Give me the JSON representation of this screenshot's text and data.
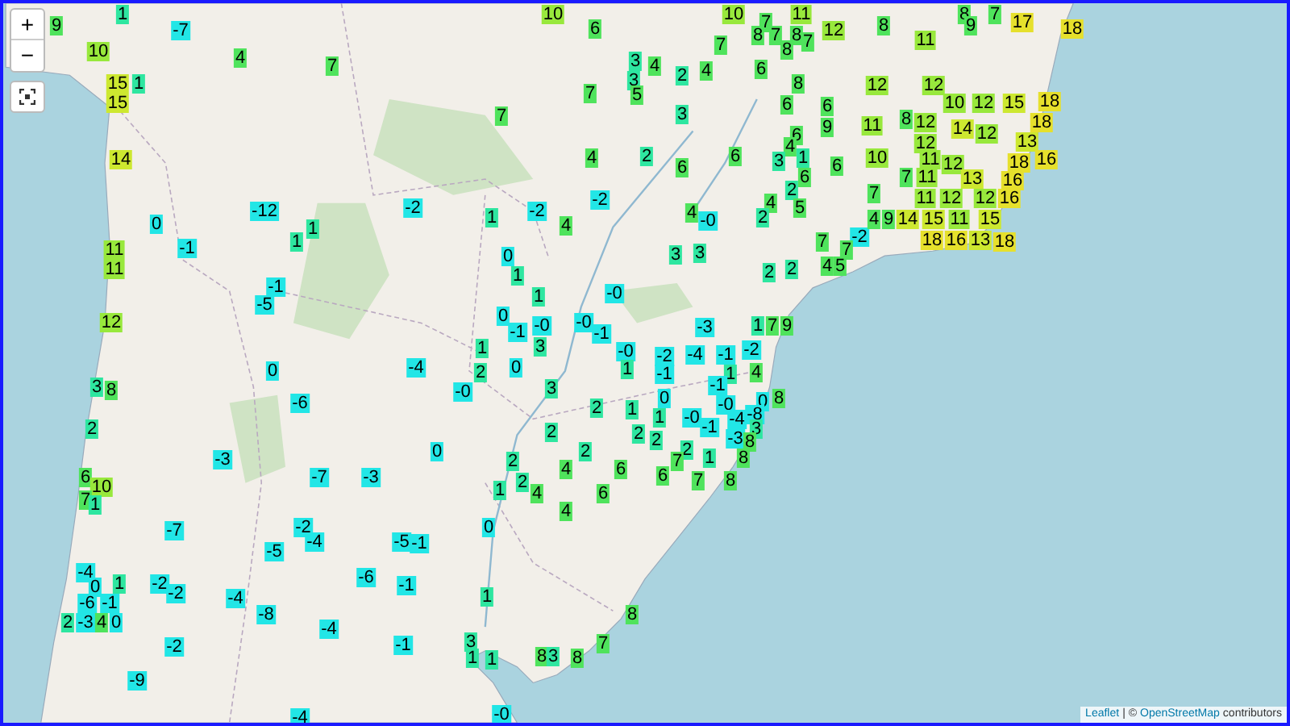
{
  "map": {
    "zoom_controls": [
      {
        "kind": "in",
        "label": "+"
      },
      {
        "kind": "out",
        "label": "−"
      }
    ],
    "markers": [
      {
        "value": "9",
        "color": "#4fe35c"
      },
      {
        "value": "1",
        "color": "#2ee6a0"
      },
      {
        "value": "-7",
        "color": "#22e6e6"
      },
      {
        "value": "4",
        "color": "#4fe35c"
      },
      {
        "value": "7",
        "color": "#4fe35c"
      },
      {
        "value": "10",
        "color": "#98e83c"
      },
      {
        "value": "15",
        "color": "#cde830"
      },
      {
        "value": "15",
        "color": "#cde830"
      },
      {
        "value": "1",
        "color": "#2ee6a0"
      },
      {
        "value": "14",
        "color": "#cde830"
      },
      {
        "value": "-12",
        "color": "#22e6e6"
      },
      {
        "value": "-2",
        "color": "#22e6e6"
      },
      {
        "value": "0",
        "color": "#22e6e6"
      },
      {
        "value": "-1",
        "color": "#22e6e6"
      },
      {
        "value": "1",
        "color": "#2ee6a0"
      },
      {
        "value": "1",
        "color": "#2ee6a0"
      },
      {
        "value": "11",
        "color": "#98e83c"
      },
      {
        "value": "11",
        "color": "#98e83c"
      },
      {
        "value": "-1",
        "color": "#22e6e6"
      },
      {
        "value": "-5",
        "color": "#22e6e6"
      },
      {
        "value": "12",
        "color": "#98e83c"
      },
      {
        "value": "10",
        "color": "#98e83c"
      },
      {
        "value": "10",
        "color": "#98e83c"
      },
      {
        "value": "7",
        "color": "#4fe35c"
      },
      {
        "value": "11",
        "color": "#98e83c"
      },
      {
        "value": "6",
        "color": "#4fe35c"
      },
      {
        "value": "8",
        "color": "#4fe35c"
      },
      {
        "value": "7",
        "color": "#4fe35c"
      },
      {
        "value": "8",
        "color": "#4fe35c"
      },
      {
        "value": "12",
        "color": "#98e83c"
      },
      {
        "value": "7",
        "color": "#4fe35c"
      },
      {
        "value": "7",
        "color": "#4fe35c"
      },
      {
        "value": "8",
        "color": "#4fe35c"
      },
      {
        "value": "3",
        "color": "#2ee6a0"
      },
      {
        "value": "4",
        "color": "#4fe35c"
      },
      {
        "value": "3",
        "color": "#2ee6a0"
      },
      {
        "value": "2",
        "color": "#2ee6a0"
      },
      {
        "value": "4",
        "color": "#4fe35c"
      },
      {
        "value": "6",
        "color": "#4fe35c"
      },
      {
        "value": "8",
        "color": "#4fe35c"
      },
      {
        "value": "7",
        "color": "#4fe35c"
      },
      {
        "value": "5",
        "color": "#4fe35c"
      },
      {
        "value": "6",
        "color": "#4fe35c"
      },
      {
        "value": "6",
        "color": "#4fe35c"
      },
      {
        "value": "7",
        "color": "#4fe35c"
      },
      {
        "value": "3",
        "color": "#2ee6a0"
      },
      {
        "value": "9",
        "color": "#4fe35c"
      },
      {
        "value": "6",
        "color": "#4fe35c"
      },
      {
        "value": "4",
        "color": "#4fe35c"
      },
      {
        "value": "4",
        "color": "#4fe35c"
      },
      {
        "value": "2",
        "color": "#2ee6a0"
      },
      {
        "value": "6",
        "color": "#4fe35c"
      },
      {
        "value": "6",
        "color": "#4fe35c"
      },
      {
        "value": "3",
        "color": "#2ee6a0"
      },
      {
        "value": "1",
        "color": "#2ee6a0"
      },
      {
        "value": "6",
        "color": "#4fe35c"
      },
      {
        "value": "6",
        "color": "#4fe35c"
      },
      {
        "value": "2",
        "color": "#2ee6a0"
      },
      {
        "value": "-2",
        "color": "#22e6e6"
      },
      {
        "value": "4",
        "color": "#4fe35c"
      },
      {
        "value": "5",
        "color": "#4fe35c"
      },
      {
        "value": "1",
        "color": "#2ee6a0"
      },
      {
        "value": "-2",
        "color": "#22e6e6"
      },
      {
        "value": "4",
        "color": "#4fe35c"
      },
      {
        "value": "4",
        "color": "#4fe35c"
      },
      {
        "value": "-0",
        "color": "#22e6e6"
      },
      {
        "value": "2",
        "color": "#2ee6a0"
      },
      {
        "value": "7",
        "color": "#4fe35c"
      },
      {
        "value": "-2",
        "color": "#22e6e6"
      },
      {
        "value": "0",
        "color": "#22e6e6"
      },
      {
        "value": "3",
        "color": "#2ee6a0"
      },
      {
        "value": "3",
        "color": "#2ee6a0"
      },
      {
        "value": "7",
        "color": "#4fe35c"
      },
      {
        "value": "4",
        "color": "#4fe35c"
      },
      {
        "value": "5",
        "color": "#4fe35c"
      },
      {
        "value": "1",
        "color": "#2ee6a0"
      },
      {
        "value": "2",
        "color": "#2ee6a0"
      },
      {
        "value": "2",
        "color": "#2ee6a0"
      },
      {
        "value": "1",
        "color": "#2ee6a0"
      },
      {
        "value": "-0",
        "color": "#22e6e6"
      },
      {
        "value": "0",
        "color": "#22e6e6"
      },
      {
        "value": "-1",
        "color": "#22e6e6"
      },
      {
        "value": "-0",
        "color": "#22e6e6"
      },
      {
        "value": "-0",
        "color": "#22e6e6"
      },
      {
        "value": "-1",
        "color": "#22e6e6"
      },
      {
        "value": "-3",
        "color": "#22e6e6"
      },
      {
        "value": "1",
        "color": "#2ee6a0"
      },
      {
        "value": "7",
        "color": "#4fe35c"
      },
      {
        "value": "9",
        "color": "#4fe35c"
      },
      {
        "value": "1",
        "color": "#2ee6a0"
      },
      {
        "value": "3",
        "color": "#2ee6a0"
      },
      {
        "value": "-0",
        "color": "#22e6e6"
      },
      {
        "value": "-2",
        "color": "#22e6e6"
      },
      {
        "value": "-4",
        "color": "#22e6e6"
      },
      {
        "value": "-1",
        "color": "#22e6e6"
      },
      {
        "value": "-2",
        "color": "#22e6e6"
      },
      {
        "value": "8",
        "color": "#4fe35c"
      },
      {
        "value": "7",
        "color": "#4fe35c"
      },
      {
        "value": "8",
        "color": "#4fe35c"
      },
      {
        "value": "9",
        "color": "#4fe35c"
      },
      {
        "value": "17",
        "color": "#e6e02c"
      },
      {
        "value": "18",
        "color": "#e6e02c"
      },
      {
        "value": "11",
        "color": "#98e83c"
      },
      {
        "value": "12",
        "color": "#98e83c"
      },
      {
        "value": "12",
        "color": "#98e83c"
      },
      {
        "value": "10",
        "color": "#98e83c"
      },
      {
        "value": "12",
        "color": "#98e83c"
      },
      {
        "value": "15",
        "color": "#cde830"
      },
      {
        "value": "18",
        "color": "#e6e02c"
      },
      {
        "value": "11",
        "color": "#98e83c"
      },
      {
        "value": "8",
        "color": "#4fe35c"
      },
      {
        "value": "12",
        "color": "#98e83c"
      },
      {
        "value": "12",
        "color": "#98e83c"
      },
      {
        "value": "14",
        "color": "#cde830"
      },
      {
        "value": "12",
        "color": "#98e83c"
      },
      {
        "value": "18",
        "color": "#e6e02c"
      },
      {
        "value": "13",
        "color": "#cde830"
      },
      {
        "value": "10",
        "color": "#98e83c"
      },
      {
        "value": "11",
        "color": "#98e83c"
      },
      {
        "value": "12",
        "color": "#98e83c"
      },
      {
        "value": "18",
        "color": "#e6e02c"
      },
      {
        "value": "16",
        "color": "#e6e02c"
      },
      {
        "value": "7",
        "color": "#4fe35c"
      },
      {
        "value": "11",
        "color": "#98e83c"
      },
      {
        "value": "13",
        "color": "#cde830"
      },
      {
        "value": "16",
        "color": "#e6e02c"
      },
      {
        "value": "7",
        "color": "#4fe35c"
      },
      {
        "value": "11",
        "color": "#98e83c"
      },
      {
        "value": "12",
        "color": "#98e83c"
      },
      {
        "value": "12",
        "color": "#98e83c"
      },
      {
        "value": "16",
        "color": "#e6e02c"
      },
      {
        "value": "4",
        "color": "#4fe35c"
      },
      {
        "value": "9",
        "color": "#4fe35c"
      },
      {
        "value": "14",
        "color": "#cde830"
      },
      {
        "value": "15",
        "color": "#cde830"
      },
      {
        "value": "11",
        "color": "#98e83c"
      },
      {
        "value": "15",
        "color": "#cde830"
      },
      {
        "value": "18",
        "color": "#e6e02c"
      },
      {
        "value": "16",
        "color": "#e6e02c"
      },
      {
        "value": "13",
        "color": "#cde830"
      },
      {
        "value": "18",
        "color": "#e6e02c"
      },
      {
        "value": "0",
        "color": "#22e6e6"
      },
      {
        "value": "-4",
        "color": "#22e6e6"
      },
      {
        "value": "3",
        "color": "#2ee6a0"
      },
      {
        "value": "8",
        "color": "#4fe35c"
      },
      {
        "value": "-6",
        "color": "#22e6e6"
      },
      {
        "value": "2",
        "color": "#2ee6a0"
      },
      {
        "value": "-3",
        "color": "#22e6e6"
      },
      {
        "value": "6",
        "color": "#4fe35c"
      },
      {
        "value": "10",
        "color": "#98e83c"
      },
      {
        "value": "-7",
        "color": "#22e6e6"
      },
      {
        "value": "-3",
        "color": "#22e6e6"
      },
      {
        "value": "7",
        "color": "#4fe35c"
      },
      {
        "value": "1",
        "color": "#2ee6a0"
      },
      {
        "value": "-7",
        "color": "#22e6e6"
      },
      {
        "value": "-2",
        "color": "#22e6e6"
      },
      {
        "value": "-4",
        "color": "#22e6e6"
      },
      {
        "value": "-5",
        "color": "#22e6e6"
      },
      {
        "value": "-5",
        "color": "#22e6e6"
      },
      {
        "value": "-1",
        "color": "#22e6e6"
      },
      {
        "value": "-4",
        "color": "#22e6e6"
      },
      {
        "value": "0",
        "color": "#22e6e6"
      },
      {
        "value": "1",
        "color": "#2ee6a0"
      },
      {
        "value": "-2",
        "color": "#22e6e6"
      },
      {
        "value": "-2",
        "color": "#22e6e6"
      },
      {
        "value": "-6",
        "color": "#22e6e6"
      },
      {
        "value": "-1",
        "color": "#22e6e6"
      },
      {
        "value": "-6",
        "color": "#22e6e6"
      },
      {
        "value": "-1",
        "color": "#22e6e6"
      },
      {
        "value": "2",
        "color": "#2ee6a0"
      },
      {
        "value": "-3",
        "color": "#22e6e6"
      },
      {
        "value": "4",
        "color": "#4fe35c"
      },
      {
        "value": "0",
        "color": "#22e6e6"
      },
      {
        "value": "-4",
        "color": "#22e6e6"
      },
      {
        "value": "-8",
        "color": "#22e6e6"
      },
      {
        "value": "-4",
        "color": "#22e6e6"
      },
      {
        "value": "-2",
        "color": "#22e6e6"
      },
      {
        "value": "-1",
        "color": "#22e6e6"
      },
      {
        "value": "-9",
        "color": "#22e6e6"
      },
      {
        "value": "-4",
        "color": "#22e6e6"
      },
      {
        "value": "2",
        "color": "#2ee6a0"
      },
      {
        "value": "0",
        "color": "#22e6e6"
      },
      {
        "value": "1",
        "color": "#2ee6a0"
      },
      {
        "value": "-1",
        "color": "#22e6e6"
      },
      {
        "value": "1",
        "color": "#2ee6a0"
      },
      {
        "value": "4",
        "color": "#4fe35c"
      },
      {
        "value": "-0",
        "color": "#22e6e6"
      },
      {
        "value": "3",
        "color": "#2ee6a0"
      },
      {
        "value": "-1",
        "color": "#22e6e6"
      },
      {
        "value": "0",
        "color": "#22e6e6"
      },
      {
        "value": "-0",
        "color": "#22e6e6"
      },
      {
        "value": "0",
        "color": "#22e6e6"
      },
      {
        "value": "8",
        "color": "#4fe35c"
      },
      {
        "value": "2",
        "color": "#2ee6a0"
      },
      {
        "value": "1",
        "color": "#2ee6a0"
      },
      {
        "value": "1",
        "color": "#2ee6a0"
      },
      {
        "value": "-0",
        "color": "#22e6e6"
      },
      {
        "value": "-4",
        "color": "#22e6e6"
      },
      {
        "value": "-8",
        "color": "#22e6e6"
      },
      {
        "value": "2",
        "color": "#2ee6a0"
      },
      {
        "value": "-1",
        "color": "#22e6e6"
      },
      {
        "value": "3",
        "color": "#2ee6a0"
      },
      {
        "value": "-3",
        "color": "#22e6e6"
      },
      {
        "value": "0",
        "color": "#22e6e6"
      },
      {
        "value": "2",
        "color": "#2ee6a0"
      },
      {
        "value": "2",
        "color": "#2ee6a0"
      },
      {
        "value": "8",
        "color": "#4fe35c"
      },
      {
        "value": "2",
        "color": "#2ee6a0"
      },
      {
        "value": "2",
        "color": "#2ee6a0"
      },
      {
        "value": "2",
        "color": "#2ee6a0"
      },
      {
        "value": "7",
        "color": "#4fe35c"
      },
      {
        "value": "1",
        "color": "#2ee6a0"
      },
      {
        "value": "8",
        "color": "#4fe35c"
      },
      {
        "value": "2",
        "color": "#2ee6a0"
      },
      {
        "value": "4",
        "color": "#4fe35c"
      },
      {
        "value": "6",
        "color": "#4fe35c"
      },
      {
        "value": "6",
        "color": "#4fe35c"
      },
      {
        "value": "7",
        "color": "#4fe35c"
      },
      {
        "value": "8",
        "color": "#4fe35c"
      },
      {
        "value": "1",
        "color": "#2ee6a0"
      },
      {
        "value": "4",
        "color": "#4fe35c"
      },
      {
        "value": "6",
        "color": "#4fe35c"
      },
      {
        "value": "4",
        "color": "#4fe35c"
      },
      {
        "value": "0",
        "color": "#22e6e6"
      },
      {
        "value": "1",
        "color": "#2ee6a0"
      },
      {
        "value": "8",
        "color": "#4fe35c"
      },
      {
        "value": "3",
        "color": "#2ee6a0"
      },
      {
        "value": "7",
        "color": "#4fe35c"
      },
      {
        "value": "1",
        "color": "#2ee6a0"
      },
      {
        "value": "1",
        "color": "#2ee6a0"
      },
      {
        "value": "8",
        "color": "#4fe35c"
      },
      {
        "value": "3",
        "color": "#2ee6a0"
      },
      {
        "value": "8",
        "color": "#4fe35c"
      },
      {
        "value": "-0",
        "color": "#22e6e6"
      }
    ]
  },
  "attribution": {
    "leaflet": "Leaflet",
    "separator": "| ©",
    "osm": "OpenStreetMap",
    "suffix": "contributors"
  }
}
